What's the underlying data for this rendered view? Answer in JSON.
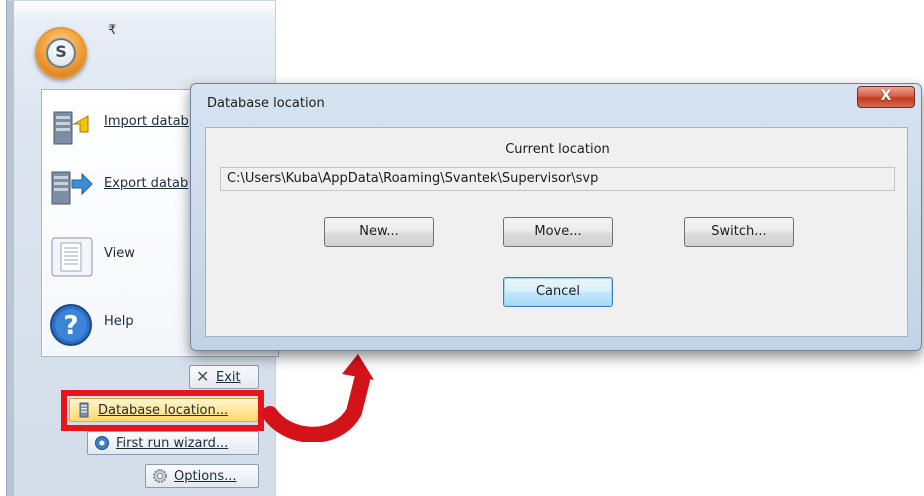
{
  "app": {
    "quick_access_caret": "₹",
    "orb_glyph": "S",
    "menu_items": [
      {
        "label": "Import datab",
        "icon": "import-database-icon"
      },
      {
        "label": "Export datab",
        "icon": "export-database-icon"
      },
      {
        "label": "View",
        "icon": "view-document-icon"
      },
      {
        "label": "Help",
        "icon": "help-icon"
      }
    ],
    "bottom_buttons": {
      "exit": {
        "glyph": "✕",
        "label": "Exit",
        "icon": "close-icon"
      },
      "database_location": {
        "label": "Database location...",
        "icon": "database-icon"
      },
      "first_run_wizard": {
        "label": "First run wizard...",
        "icon": "wizard-gear-icon"
      },
      "options": {
        "label": "Options...",
        "icon": "gear-icon"
      }
    }
  },
  "dialog": {
    "title": "Database location",
    "close_glyph": "X",
    "current_location_label": "Current location",
    "path": "C:\\Users\\Kuba\\AppData\\Roaming\\Svantek\\Supervisor\\svp",
    "buttons": {
      "new": "New...",
      "move": "Move...",
      "switch": "Switch...",
      "cancel": "Cancel"
    }
  },
  "colors": {
    "highlight_frame": "#e8141c",
    "arrow": "#d4121a",
    "dialog_frame": "#c3d3e6"
  }
}
